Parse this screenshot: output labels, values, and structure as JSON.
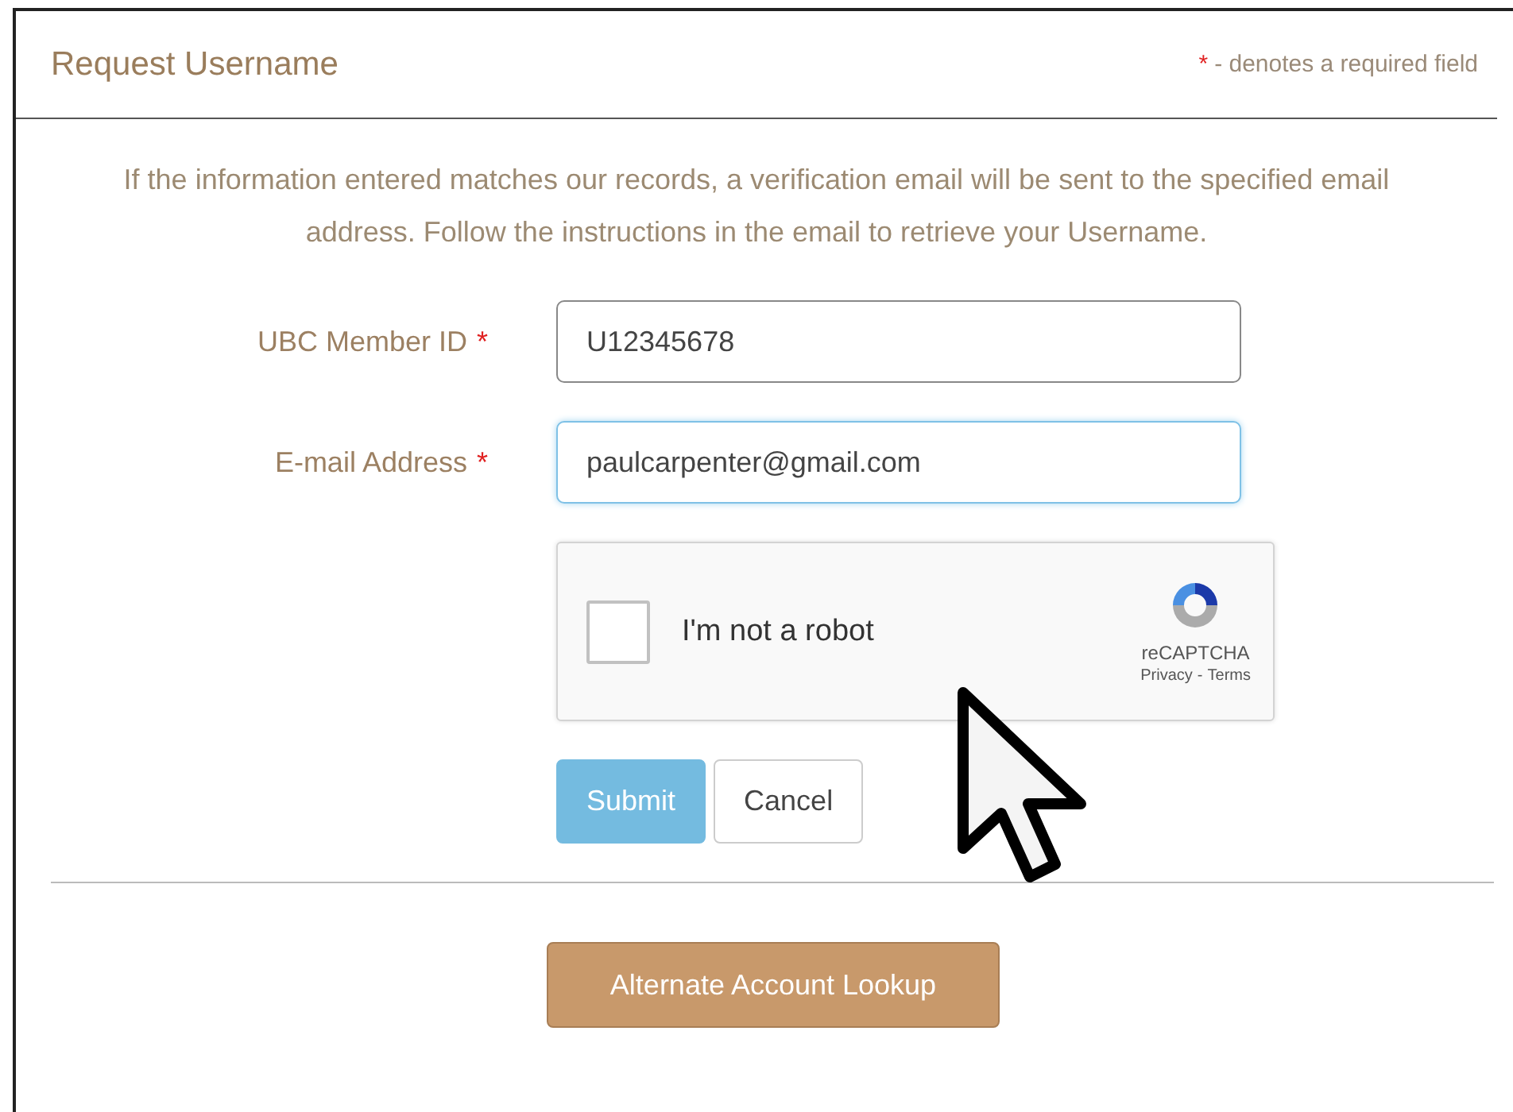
{
  "header": {
    "title": "Request Username",
    "required_mark": "*",
    "required_note": "- denotes a required field"
  },
  "intro": "If the information entered matches our records, a verification email will be sent to the specified email address. Follow the instructions in the email to retrieve your Username.",
  "fields": [
    {
      "label": "UBC Member ID",
      "required_mark": "*",
      "value": "U12345678",
      "focused": false
    },
    {
      "label": "E-mail Address",
      "required_mark": "*",
      "value": "paulcarpenter@gmail.com",
      "focused": true
    }
  ],
  "captcha": {
    "label": "I'm not a robot",
    "checked": false,
    "brand": "reCAPTCHA",
    "privacy": "Privacy",
    "separator": "-",
    "terms": "Terms"
  },
  "buttons": [
    {
      "kind": "primary",
      "label": "Submit",
      "disabled": true
    },
    {
      "kind": "secondary",
      "label": "Cancel",
      "disabled": false
    }
  ],
  "alternate_button": "Alternate Account Lookup"
}
